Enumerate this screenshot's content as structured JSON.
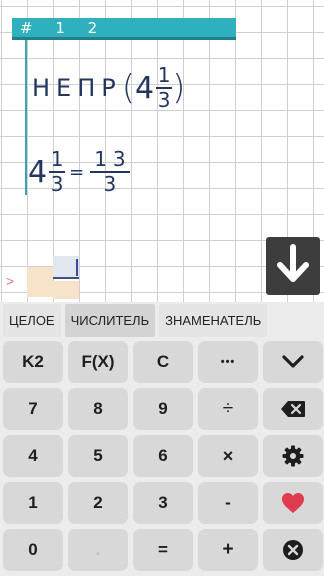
{
  "task": {
    "number": "# 1 2"
  },
  "expression": {
    "function": "НЕПР",
    "open_paren": "(",
    "close_paren": ")",
    "whole": "4",
    "numerator": "1",
    "denominator": "3"
  },
  "result": {
    "whole": "4",
    "numerator": "1",
    "denominator": "3",
    "equals": "=",
    "result_numerator": "13",
    "result_denominator": "3"
  },
  "input": {
    "marker": ">"
  },
  "modes": {
    "whole": "ЦЕЛОЕ",
    "numerator": "ЧИСЛИТЕЛЬ",
    "denominator": "ЗНАМЕНАТЕЛЬ",
    "active": "numerator"
  },
  "keys": {
    "k2": "K2",
    "fx": "F(X)",
    "clear": "C",
    "more": "•••",
    "n7": "7",
    "n8": "8",
    "n9": "9",
    "divide": "÷",
    "n4": "4",
    "n5": "5",
    "n6": "6",
    "multiply": "×",
    "n1": "1",
    "n2": "2",
    "n3": "3",
    "minus": "-",
    "n0": "0",
    "dot": ".",
    "equals": "=",
    "plus": "+"
  },
  "icons": {
    "down_arrow": "arrow-down-icon",
    "chevron": "chevron-down-icon",
    "backspace": "backspace-icon",
    "settings": "gear-icon",
    "favorite": "heart-icon",
    "close": "close-icon"
  },
  "colors": {
    "header": "#2fb0bf",
    "ink": "#23365f",
    "heart": "#e03a4e",
    "input_highlight": "#f7e3c9"
  }
}
